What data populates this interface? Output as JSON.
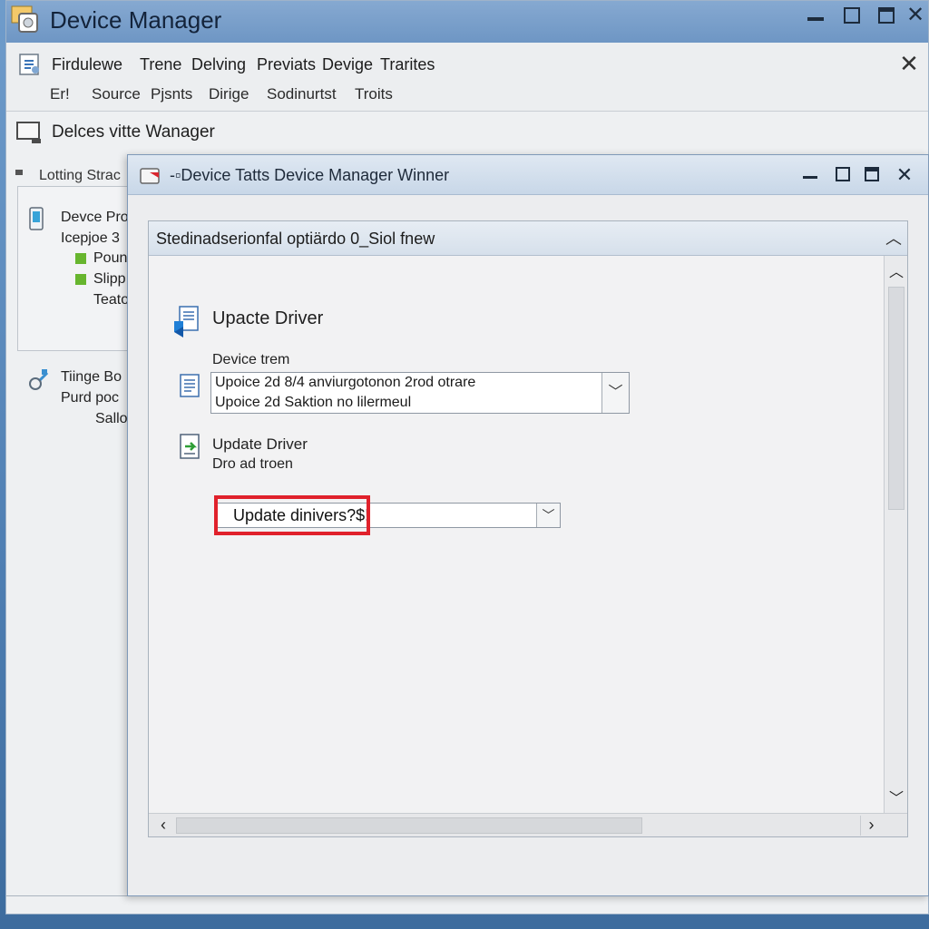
{
  "main_window": {
    "title": "Device Manager",
    "menu_items": [
      "Firdulewe",
      "Trene",
      "Delving",
      "Previats",
      "Devige",
      "Trarites"
    ],
    "toolbar_items": [
      "Er!",
      "Source",
      "Pjsnts",
      "Dirige",
      "Sodinurtst",
      "Troits"
    ],
    "device_row_label": "Delces vitte Wanager",
    "side_heading": "Lotting Strac",
    "side_items": [
      "Devce Pro",
      "Icepjoe 3",
      "Poun",
      "Slipp",
      "Teato"
    ],
    "side_items_2": [
      "Tiinge Bo",
      "Purd poc",
      "Sallo"
    ]
  },
  "dialog": {
    "title": "-▫Device  Tatts  Device Manager  Winner",
    "panel_header": "Stedinadserionfal optiärdo 0_Siol fnew",
    "section_title": "Upacte Driver",
    "device_tree_label": "Device trem",
    "device_select_lines": [
      "Upoice 2d 8/4 anviurgotonon 2rod otrare",
      "Upoice 2d Saktion no lilermeul"
    ],
    "update_driver_label": "Update Driver",
    "driver_subtext": "Dro ad troen",
    "update_combo_value": "Update dinivers?$!"
  },
  "icons": {
    "app": "device-manager-icon",
    "menu": "properties-icon",
    "monitor": "monitor-icon",
    "phone": "phone-icon",
    "usb": "usb-icon",
    "dialog": "dialog-icon",
    "update": "update-driver-icon",
    "doc": "document-icon",
    "driver": "driver-file-icon"
  },
  "colors": {
    "highlight": "#e0212b",
    "status_green": "#67b52e",
    "titlebar": "#6e96c4"
  }
}
